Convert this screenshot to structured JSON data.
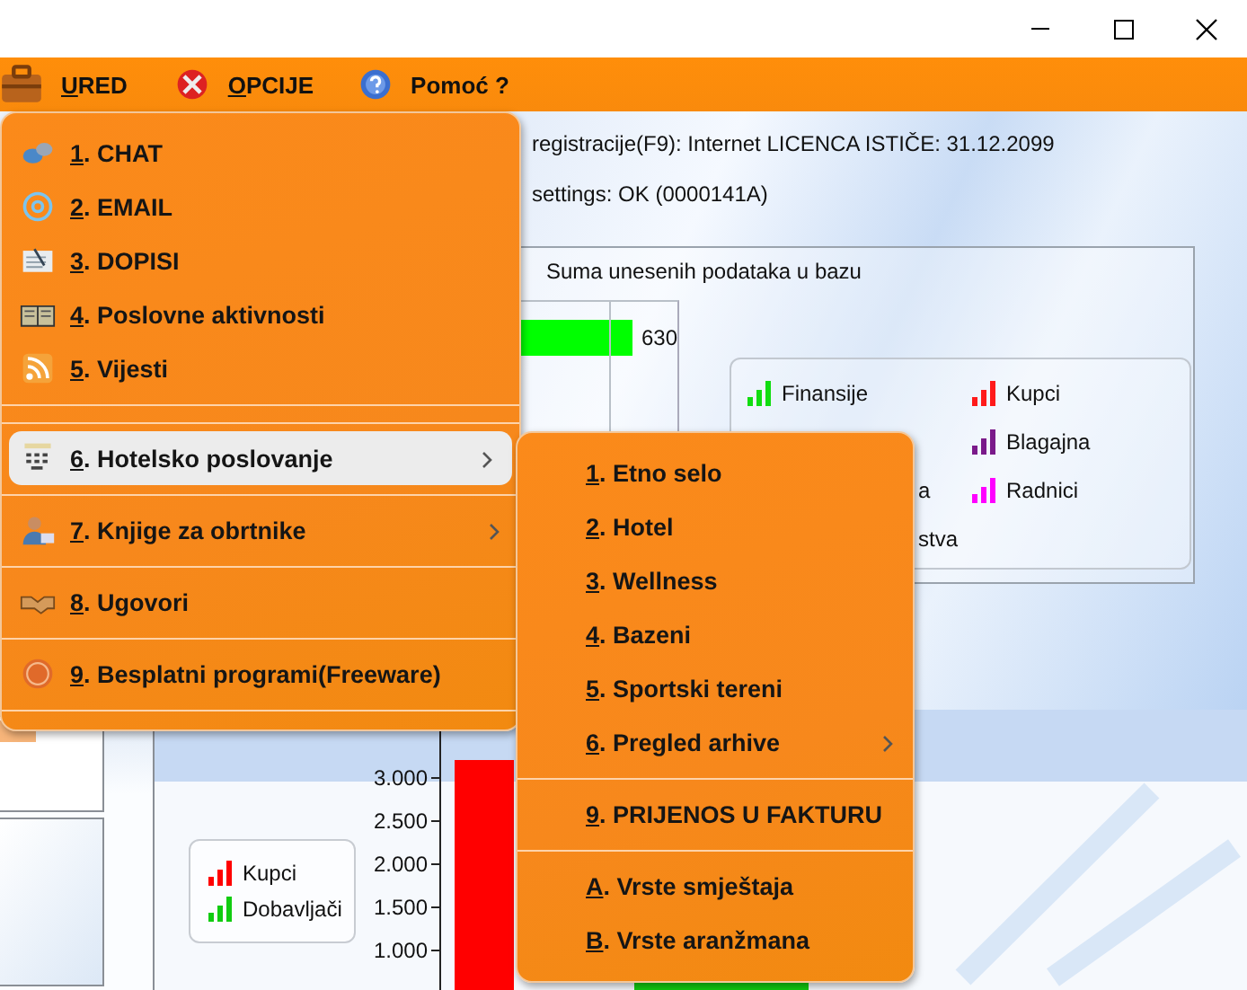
{
  "menu_bar": [
    {
      "label": "URED",
      "mnemonic": true
    },
    {
      "label": "OPCIJE",
      "mnemonic": true
    },
    {
      "label": "Pomoć ?",
      "mnemonic": false
    }
  ],
  "status_lines": [
    "registracije(F9): Internet  LICENCA ISTIČE: 31.12.2099",
    "settings: OK (0000141A)"
  ],
  "summary": {
    "title": "Suma unesenih podataka u bazu",
    "bar_value": "630",
    "legend": [
      {
        "label": "Finansije",
        "color": "#11dd11"
      },
      {
        "label": "Kupci",
        "color": "#ff1a1a"
      },
      {
        "label": "Blagajna",
        "color": "#7a1a8a"
      },
      {
        "label": "Radnici",
        "color": "#ff00ff"
      }
    ],
    "cut_labels": [
      "a",
      "stva"
    ]
  },
  "lower_chart": {
    "legend": [
      {
        "label": "Kupci",
        "color": "#ff0000"
      },
      {
        "label": "Dobavljači",
        "color": "#11cc11"
      }
    ],
    "axis_labels": [
      "3.000",
      "2.500",
      "2.000",
      "1.500",
      "1.000"
    ]
  },
  "main_menu": [
    {
      "kind": "item",
      "label": "1. CHAT",
      "selected": false,
      "submenu": false
    },
    {
      "kind": "item",
      "label": "2. EMAIL",
      "selected": false,
      "submenu": false
    },
    {
      "kind": "item",
      "label": "3. DOPISI",
      "selected": false,
      "submenu": false
    },
    {
      "kind": "item",
      "label": "4. Poslovne aktivnosti",
      "selected": false,
      "submenu": false
    },
    {
      "kind": "item",
      "label": "5. Vijesti",
      "selected": false,
      "submenu": false
    },
    {
      "kind": "separator"
    },
    {
      "kind": "separator"
    },
    {
      "kind": "item",
      "label": "6. Hotelsko poslovanje",
      "selected": true,
      "submenu": true
    },
    {
      "kind": "separator"
    },
    {
      "kind": "item",
      "label": "7. Knjige za obrtnike",
      "selected": false,
      "submenu": true
    },
    {
      "kind": "separator"
    },
    {
      "kind": "item",
      "label": "8. Ugovori",
      "selected": false,
      "submenu": false
    },
    {
      "kind": "separator"
    },
    {
      "kind": "item",
      "label": "9. Besplatni programi(Freeware)",
      "selected": false,
      "submenu": false
    },
    {
      "kind": "separator"
    }
  ],
  "sub_menu": [
    {
      "kind": "item",
      "label": "1. Etno selo",
      "selected": false,
      "submenu": false
    },
    {
      "kind": "item",
      "label": "2. Hotel",
      "selected": false,
      "submenu": false
    },
    {
      "kind": "item",
      "label": "3. Wellness",
      "selected": false,
      "submenu": false
    },
    {
      "kind": "item",
      "label": "4. Bazeni",
      "selected": false,
      "submenu": false
    },
    {
      "kind": "item",
      "label": "5. Sportski tereni",
      "selected": false,
      "submenu": false
    },
    {
      "kind": "item",
      "label": "6. Pregled arhive",
      "selected": false,
      "submenu": true
    },
    {
      "kind": "separator"
    },
    {
      "kind": "item",
      "label": "9. PRIJENOS U FAKTURU",
      "selected": false,
      "submenu": false
    },
    {
      "kind": "separator"
    },
    {
      "kind": "item",
      "label": "A. Vrste smještaja",
      "selected": false,
      "submenu": false
    },
    {
      "kind": "item",
      "label": "B. Vrste aranžmana",
      "selected": false,
      "submenu": false
    }
  ]
}
